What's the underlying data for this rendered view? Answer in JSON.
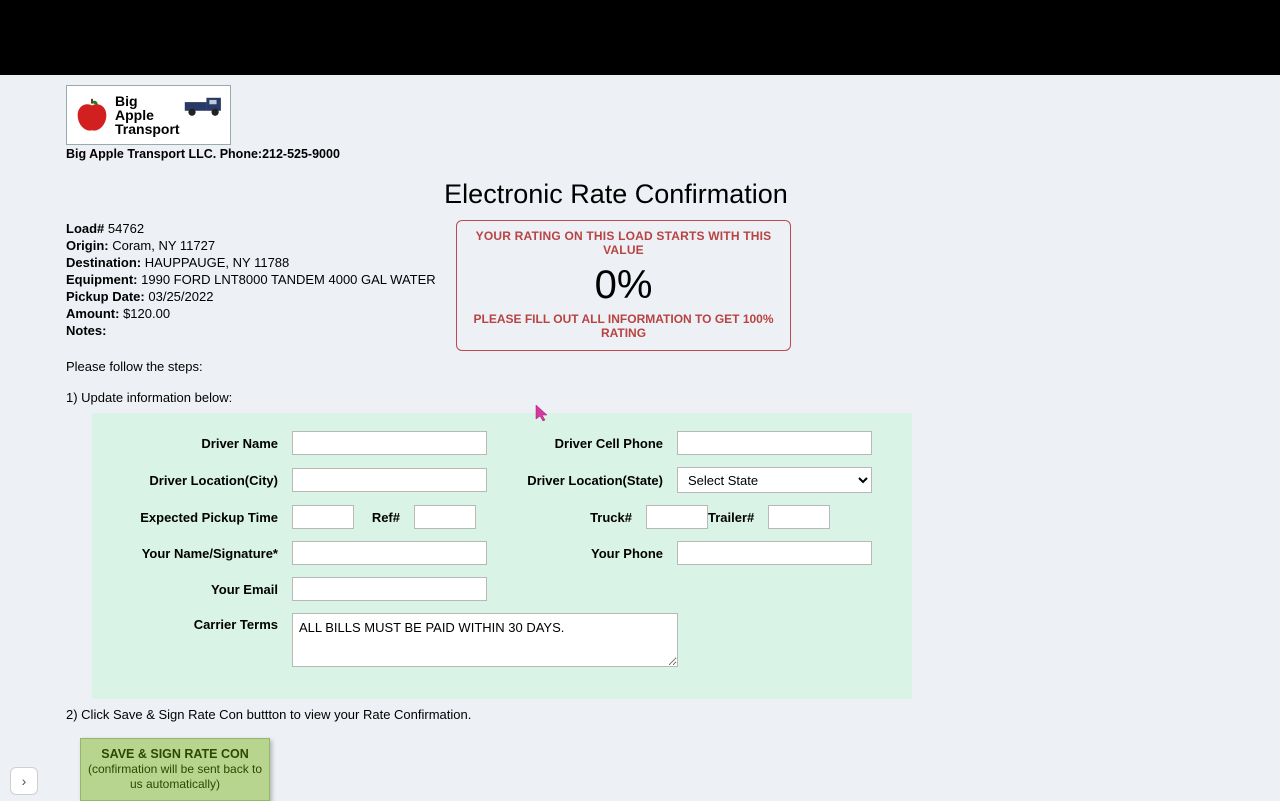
{
  "company": {
    "logo_text": "Big\nApple\nTransport",
    "line": "Big Apple Transport LLC. Phone:212-525-9000"
  },
  "title": "Electronic Rate Confirmation",
  "details": {
    "load_label": "Load#",
    "load_value": "54762",
    "origin_label": "Origin:",
    "origin_value": "Coram, NY 11727",
    "dest_label": "Destination:",
    "dest_value": "HAUPPAUGE, NY 11788",
    "equip_label": "Equipment:",
    "equip_value": "1990 FORD LNT8000 TANDEM 4000 GAL WATER",
    "pickup_label": "Pickup Date:",
    "pickup_value": "03/25/2022",
    "amount_label": "Amount:",
    "amount_value": "$120.00",
    "notes_label": "Notes:",
    "notes_value": ""
  },
  "rating": {
    "top": "YOUR RATING ON THIS LOAD STARTS WITH THIS VALUE",
    "pct": "0%",
    "bottom": "PLEASE FILL OUT ALL INFORMATION TO GET 100% RATING"
  },
  "steps": {
    "intro": "Please follow the steps:",
    "s1": "1) Update information below:",
    "s2": "2) Click Save & Sign Rate Con buttton to view your Rate Confirmation."
  },
  "form": {
    "driver_name_label": "Driver Name",
    "driver_cell_label": "Driver Cell Phone",
    "driver_city_label": "Driver Location(City)",
    "driver_state_label": "Driver Location(State)",
    "state_selected": "Select State",
    "pickup_time_label": "Expected Pickup Time",
    "ref_label": "Ref#",
    "truck_label": "Truck#",
    "trailer_label": "Trailer#",
    "your_name_label": "Your Name/Signature*",
    "your_phone_label": "Your Phone",
    "your_email_label": "Your Email",
    "carrier_terms_label": "Carrier Terms",
    "carrier_terms_value": "ALL BILLS MUST BE PAID WITHIN 30 DAYS."
  },
  "save_button": {
    "line1": "SAVE & SIGN RATE CON",
    "line2": "(confirmation will be sent back to us automatically)"
  }
}
